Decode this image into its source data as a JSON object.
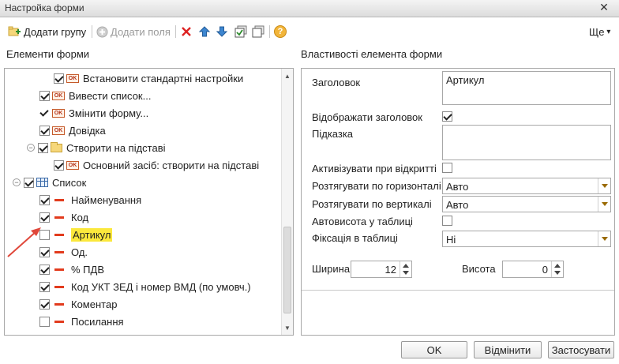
{
  "window": {
    "title": "Настройка форми",
    "close_glyph": "✕"
  },
  "toolbar": {
    "add_group_label": "Додати групу",
    "add_fields_label": "Додати поля",
    "more_label": "Ще",
    "more_glyph": "▾",
    "help_glyph": "?",
    "icons": [
      "add-group-icon",
      "add-fields-icon",
      "delete-icon",
      "move-up-icon",
      "move-down-icon",
      "check-all-icon",
      "uncheck-all-icon",
      "help-icon"
    ]
  },
  "left_panel": {
    "title": "Елементи форми",
    "items": [
      {
        "label": "Встановити стандартні настройки",
        "checked": true,
        "icon": "ok"
      },
      {
        "label": "Вивести список...",
        "checked": true,
        "icon": "ok"
      },
      {
        "label": "Змінити форму...",
        "checked": true,
        "icon": "ok"
      },
      {
        "label": "Довідка",
        "checked": true,
        "icon": "ok"
      },
      {
        "label": "Створити на підставі",
        "checked": true,
        "icon": "folder"
      },
      {
        "label": "Основний засіб: створити на підставі",
        "checked": true,
        "icon": "ok"
      },
      {
        "label": "Список",
        "checked": true,
        "icon": "table"
      },
      {
        "label": "Найменування",
        "checked": true,
        "icon": "field"
      },
      {
        "label": "Код",
        "checked": true,
        "icon": "field"
      },
      {
        "label": "Артикул",
        "checked": false,
        "icon": "field",
        "selected": true
      },
      {
        "label": "Од.",
        "checked": true,
        "icon": "field"
      },
      {
        "label": "% ПДВ",
        "checked": true,
        "icon": "field"
      },
      {
        "label": "Код УКТ ЗЕД і номер ВМД (по умовч.)",
        "checked": true,
        "icon": "field"
      },
      {
        "label": "Коментар",
        "checked": true,
        "icon": "field"
      },
      {
        "label": "Посилання",
        "checked": false,
        "icon": "field"
      }
    ],
    "ok_icon_text": "OK",
    "collapse_glyph": "−"
  },
  "right_panel": {
    "title": "Властивості елемента форми",
    "heading_label": "Заголовок",
    "heading_value": "Артикул",
    "show_heading_label": "Відображати заголовок",
    "show_heading_checked": true,
    "hint_label": "Підказка",
    "hint_value": "",
    "activate_label": "Активізувати при відкритті",
    "activate_checked": false,
    "stretch_h_label": "Розтягувати по горизонталі",
    "stretch_h_value": "Авто",
    "stretch_v_label": "Розтягувати по вертикалі",
    "stretch_v_value": "Авто",
    "autoheight_label": "Автовисота у таблиці",
    "autoheight_checked": false,
    "fix_label": "Фіксація в таблиці",
    "fix_value": "Ні",
    "width_label": "Ширина",
    "width_value": "12",
    "height_label": "Висота",
    "height_value": "0"
  },
  "buttons": {
    "ok": "OK",
    "cancel": "Відмінити",
    "apply": "Застосувати"
  },
  "colors": {
    "selection": "#fbe83c",
    "field_icon": "#e23b1d",
    "annotation_arrow": "#e0473a"
  }
}
